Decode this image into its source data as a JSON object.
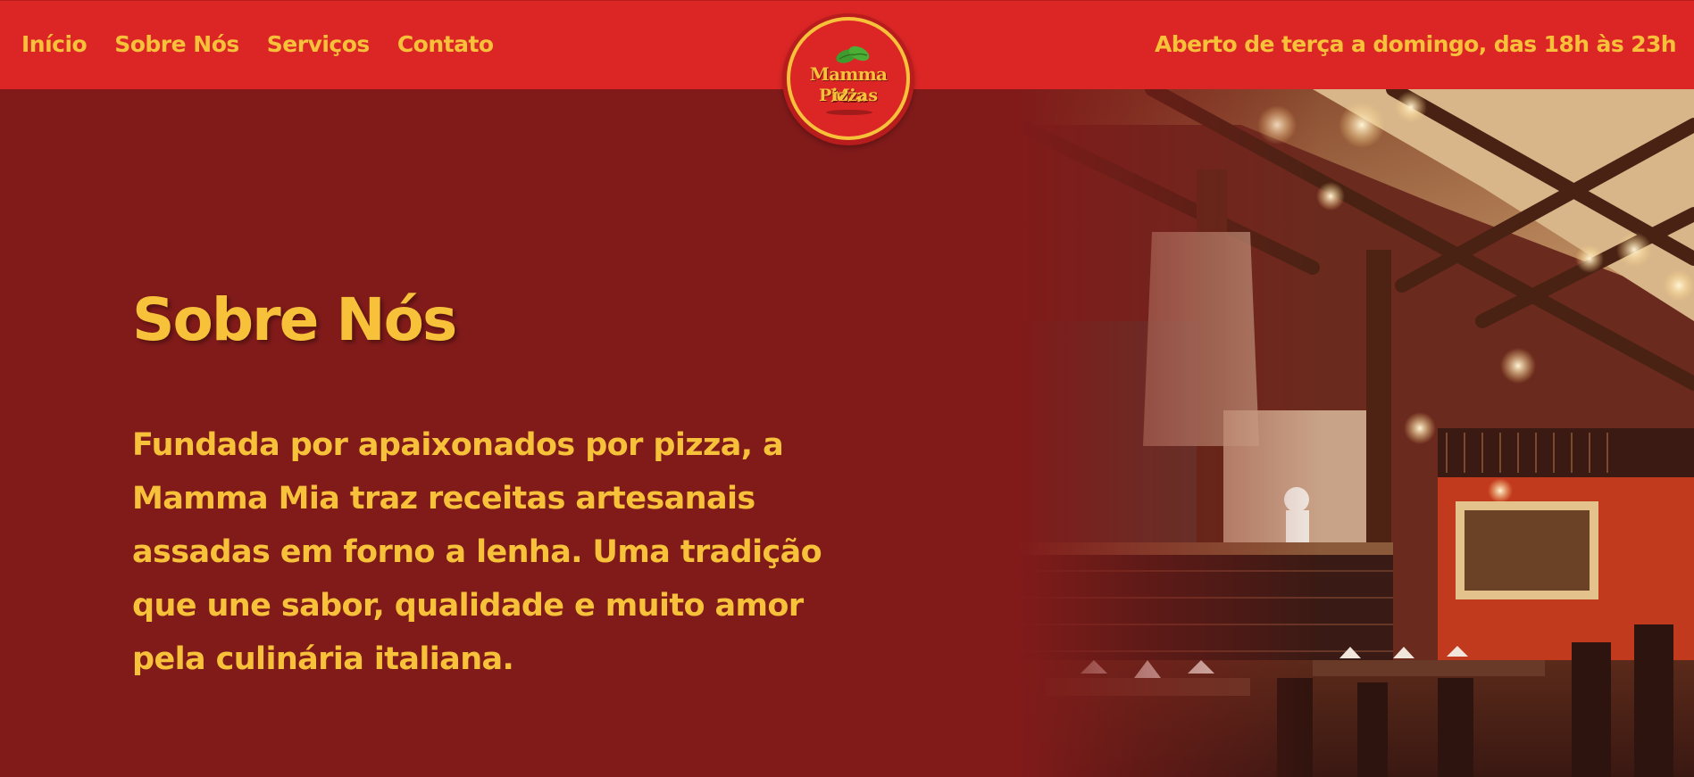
{
  "header": {
    "nav": [
      {
        "label": "Início"
      },
      {
        "label": "Sobre Nós"
      },
      {
        "label": "Serviços"
      },
      {
        "label": "Contato"
      }
    ],
    "hours": "Aberto de terça a domingo, das 18h às 23h"
  },
  "logo": {
    "line1": "Mamma Mia",
    "line2": "Pizzas",
    "icon": "basil-leaf-icon"
  },
  "about": {
    "title": "Sobre Nós",
    "text": "Fundada por apaixonados por pizza, a Mamma Mia traz receitas artesanais assadas em forno a lenha. Uma tradição que une sabor, qualidade e muito amor pela culinária italiana."
  },
  "colors": {
    "header_bg": "#dc2626",
    "page_bg": "#801b1a",
    "accent": "#f7c23a"
  }
}
